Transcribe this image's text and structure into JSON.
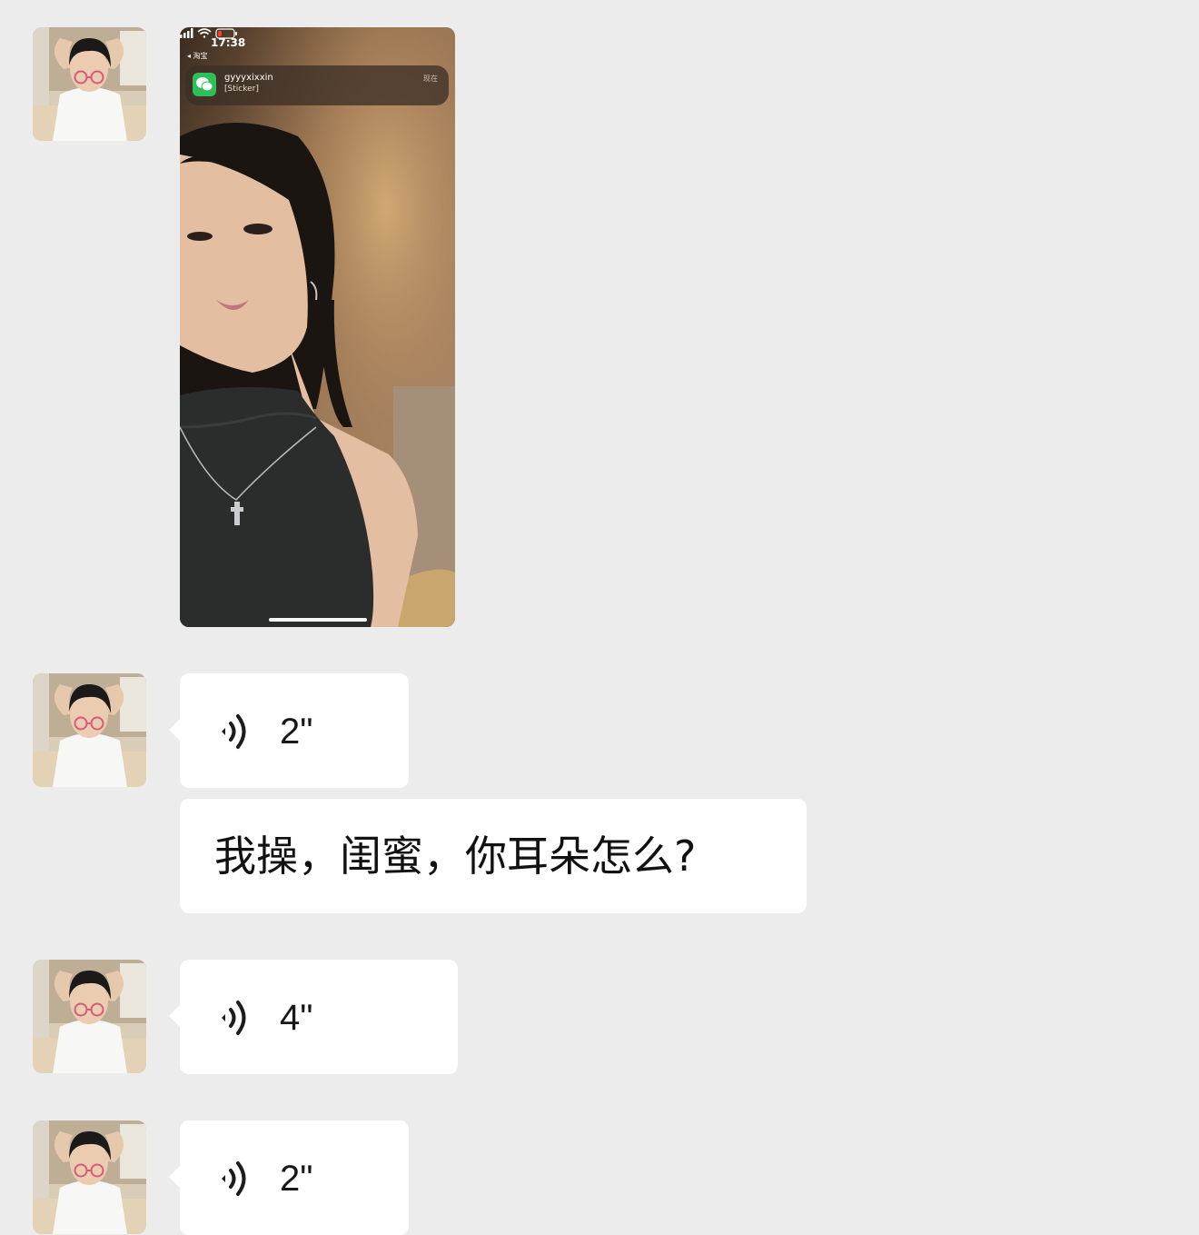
{
  "messages": [
    {
      "type": "image",
      "status_time": "17:38",
      "back_label": "◂ 淘宝",
      "notification": {
        "app_icon": "wechat-icon",
        "title": "gyyyxixxin",
        "body": "[Sticker]",
        "time": "现在"
      }
    },
    {
      "type": "voice",
      "duration": "2\""
    },
    {
      "type": "text",
      "text": "我操，闺蜜，你耳朵怎么?"
    },
    {
      "type": "voice",
      "duration": "4\""
    },
    {
      "type": "voice",
      "duration": "2\""
    }
  ],
  "colors": {
    "background": "#ececec",
    "bubble": "#ffffff",
    "wechat_green": "#2dc05a"
  },
  "icons": [
    "voice-wave-icon",
    "wechat-icon",
    "signal-icon",
    "wifi-icon",
    "battery-icon"
  ]
}
